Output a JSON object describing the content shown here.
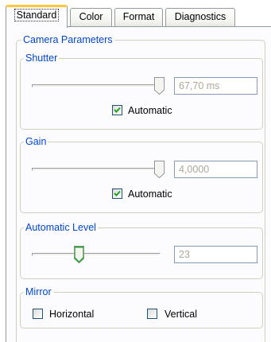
{
  "tabs": [
    {
      "label": "Standard",
      "active": true
    },
    {
      "label": "Color",
      "active": false
    },
    {
      "label": "Format",
      "active": false
    },
    {
      "label": "Diagnostics",
      "active": false
    }
  ],
  "camera_parameters": {
    "title": "Camera Parameters",
    "shutter": {
      "title": "Shutter",
      "value": "67,70 ms",
      "slider_level": 1.0,
      "automatic_label": "Automatic",
      "automatic_checked": true
    },
    "gain": {
      "title": "Gain",
      "value": "4,0000",
      "slider_level": 1.0,
      "automatic_label": "Automatic",
      "automatic_checked": true
    },
    "automatic_level": {
      "title": "Automatic Level",
      "value": "23",
      "slider_level": 0.37
    },
    "mirror": {
      "title": "Mirror",
      "horizontal_label": "Horizontal",
      "horizontal_checked": false,
      "vertical_label": "Vertical",
      "vertical_checked": false
    }
  },
  "colors": {
    "group_title": "#0046d5",
    "tab_hot": "#ffc83c",
    "check_mark": "#21a121",
    "thumb_green": "#21a121"
  }
}
